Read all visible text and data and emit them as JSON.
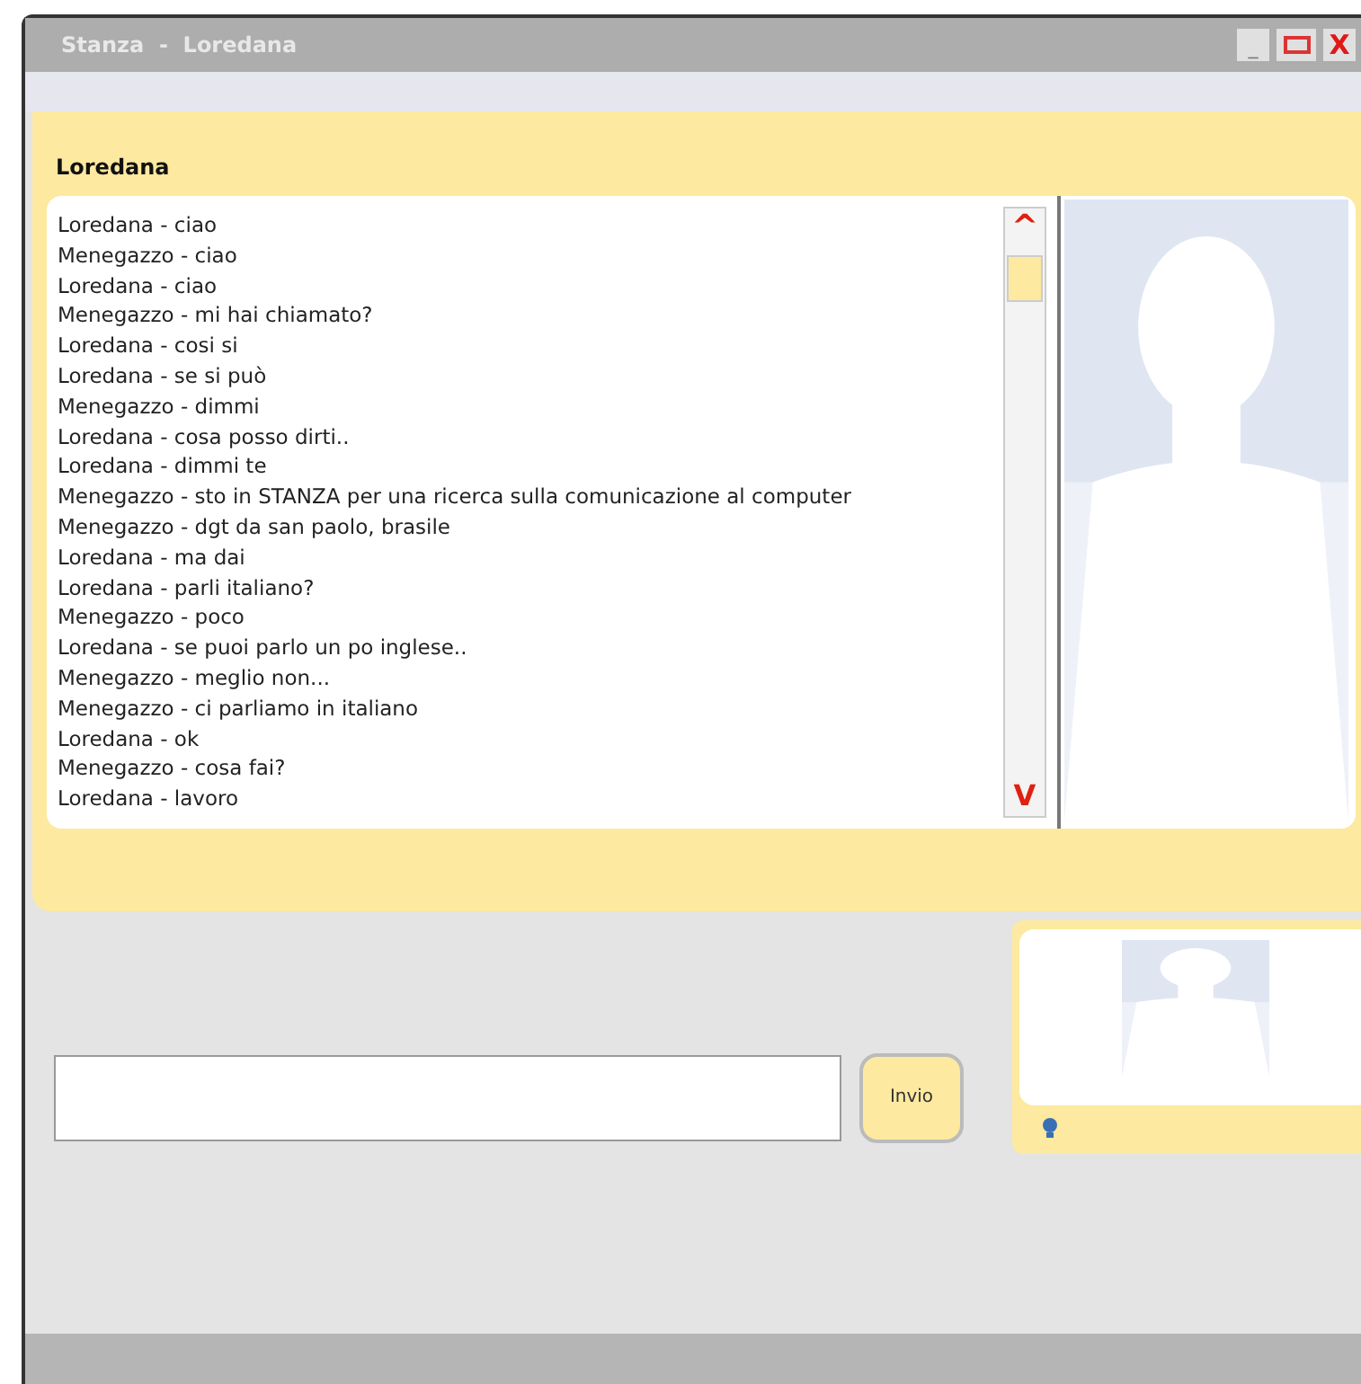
{
  "window": {
    "title": "Stanza  -  Loredana"
  },
  "chat": {
    "contact": "Loredana",
    "messages": [
      "Loredana - ciao",
      "Menegazzo - ciao",
      "Loredana - ciao",
      "Menegazzo - mi hai chiamato?",
      "Loredana - cosi si",
      "Loredana - se si può",
      "Menegazzo - dimmi",
      "Loredana - cosa posso dirti..",
      "Loredana - dimmi te",
      "Menegazzo - sto in STANZA per una ricerca sulla comunicazione al computer",
      "Menegazzo - dgt da san paolo, brasile",
      "Loredana - ma dai",
      "Loredana - parli italiano?",
      "Menegazzo - poco",
      "Loredana - se puoi parlo un po inglese..",
      "Menegazzo - meglio non...",
      "Menegazzo - ci parliamo in italiano",
      "Loredana - ok",
      "Menegazzo - cosa fai?",
      "Loredana - lavoro"
    ],
    "scroll_up": "^",
    "scroll_down": "V"
  },
  "composer": {
    "send_button": "Invio"
  },
  "window_controls": {
    "minimize": "_",
    "close": "X"
  }
}
